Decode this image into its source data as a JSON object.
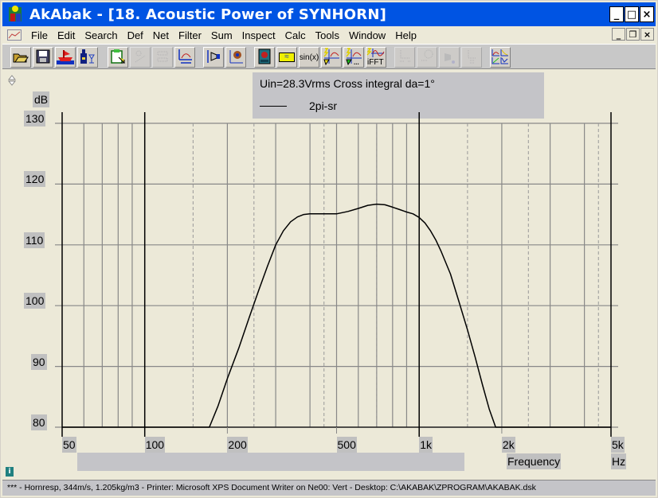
{
  "window": {
    "title": "AkAbak - [18. Acoustic Power of SYNHORN]",
    "controls": {
      "minimize": "_",
      "maximize": "□",
      "close": "×"
    },
    "mdi_controls": {
      "minimize": "_",
      "restore": "❐",
      "close": "×"
    }
  },
  "menu": {
    "items": [
      {
        "label": "File"
      },
      {
        "label": "Edit"
      },
      {
        "label": "Search"
      },
      {
        "label": "Def"
      },
      {
        "label": "Net"
      },
      {
        "label": "Filter"
      },
      {
        "label": "Sum"
      },
      {
        "label": "Inspect"
      },
      {
        "label": "Calc"
      },
      {
        "label": "Tools"
      },
      {
        "label": "Window"
      },
      {
        "label": "Help"
      }
    ]
  },
  "toolbar": {
    "buttons": [
      {
        "name": "open-icon",
        "label": "",
        "enabled": true
      },
      {
        "name": "save-icon",
        "label": "",
        "enabled": true
      },
      {
        "name": "ship-icon",
        "label": "",
        "enabled": true
      },
      {
        "name": "bottle-glass-icon",
        "label": "",
        "enabled": true
      },
      {
        "name": "clipboard-icon",
        "label": "",
        "enabled": true
      },
      {
        "name": "scatter-icon",
        "label": "",
        "enabled": false
      },
      {
        "name": "dotted-filter-icon",
        "label": "",
        "enabled": false
      },
      {
        "name": "axis-scale-icon",
        "label": "",
        "enabled": true
      },
      {
        "name": "horn-driver-icon",
        "label": "",
        "enabled": true
      },
      {
        "name": "polar-point-icon",
        "label": "",
        "enabled": true
      },
      {
        "name": "speaker-icon",
        "label": "",
        "enabled": true
      },
      {
        "name": "filter-box-icon",
        "label": "≈",
        "enabled": true
      },
      {
        "name": "sinx-icon",
        "label": "sin(x)",
        "enabled": true
      },
      {
        "name": "response-calc-icon",
        "label": "",
        "enabled": true
      },
      {
        "name": "response-calc-more-icon",
        "label": "...",
        "enabled": true
      },
      {
        "name": "ifft-icon",
        "label": "iFFT",
        "enabled": true
      },
      {
        "name": "disabled-tool-1-icon",
        "label": "",
        "enabled": false
      },
      {
        "name": "disabled-tool-2-icon",
        "label": "",
        "enabled": false
      },
      {
        "name": "disabled-tool-3-icon",
        "label": "",
        "enabled": false
      },
      {
        "name": "disabled-tool-4-icon",
        "label": "",
        "enabled": false
      },
      {
        "name": "multi-chart-icon",
        "label": "",
        "enabled": true
      }
    ]
  },
  "legend_panel": {
    "line1": "Uin=28.3Vrms Cross integral da=1°",
    "series_label": "2pi-sr"
  },
  "status_bar": {
    "text": "*** -  Hornresp, 344m/s, 1.205kg/m3 -  Printer: Microsoft XPS Document Writer on Ne00: Vert -  Desktop: C:\\AKABAK\\ZPROGRAM\\AKABAK.dsk"
  },
  "info_icon": "i",
  "chart_data": {
    "type": "line",
    "title": "Acoustic Power of SYNHORN",
    "subtitle": "Uin=28.3Vrms Cross integral da=1°",
    "xlabel": "Frequency",
    "xunit": "Hz",
    "ylabel": "dB",
    "xscale": "log",
    "xlim": [
      50,
      5000
    ],
    "ylim": [
      80,
      130
    ],
    "grid": true,
    "legend": "top-center",
    "x_tick_labels": [
      {
        "value": 50,
        "label": "50"
      },
      {
        "value": 100,
        "label": "100"
      },
      {
        "value": 200,
        "label": "200"
      },
      {
        "value": 500,
        "label": "500"
      },
      {
        "value": 1000,
        "label": "1k"
      },
      {
        "value": 2000,
        "label": "2k"
      },
      {
        "value": 5000,
        "label": "5k"
      }
    ],
    "y_ticks": [
      80,
      90,
      100,
      110,
      120,
      130
    ],
    "series": [
      {
        "name": "2pi-sr",
        "color": "#000000",
        "x": [
          50,
          100,
          150,
          172,
          185,
          200,
          220,
          240,
          260,
          280,
          300,
          320,
          340,
          360,
          380,
          400,
          450,
          500,
          550,
          600,
          650,
          700,
          750,
          800,
          850,
          900,
          950,
          1000,
          1050,
          1100,
          1150,
          1200,
          1300,
          1400,
          1500,
          1600,
          1700,
          1800,
          1900,
          2000,
          3000,
          5000
        ],
        "y": [
          80,
          80,
          80,
          80,
          83.5,
          88,
          93,
          98,
          102.5,
          106.5,
          110,
          112.3,
          113.8,
          114.6,
          115,
          115.1,
          115.1,
          115.1,
          115.5,
          116,
          116.5,
          116.7,
          116.6,
          116.2,
          115.8,
          115.4,
          115.1,
          114.5,
          113.6,
          112.3,
          110.8,
          109,
          105.2,
          100.5,
          96,
          91.5,
          87,
          83,
          80,
          80,
          80,
          80
        ]
      }
    ]
  }
}
